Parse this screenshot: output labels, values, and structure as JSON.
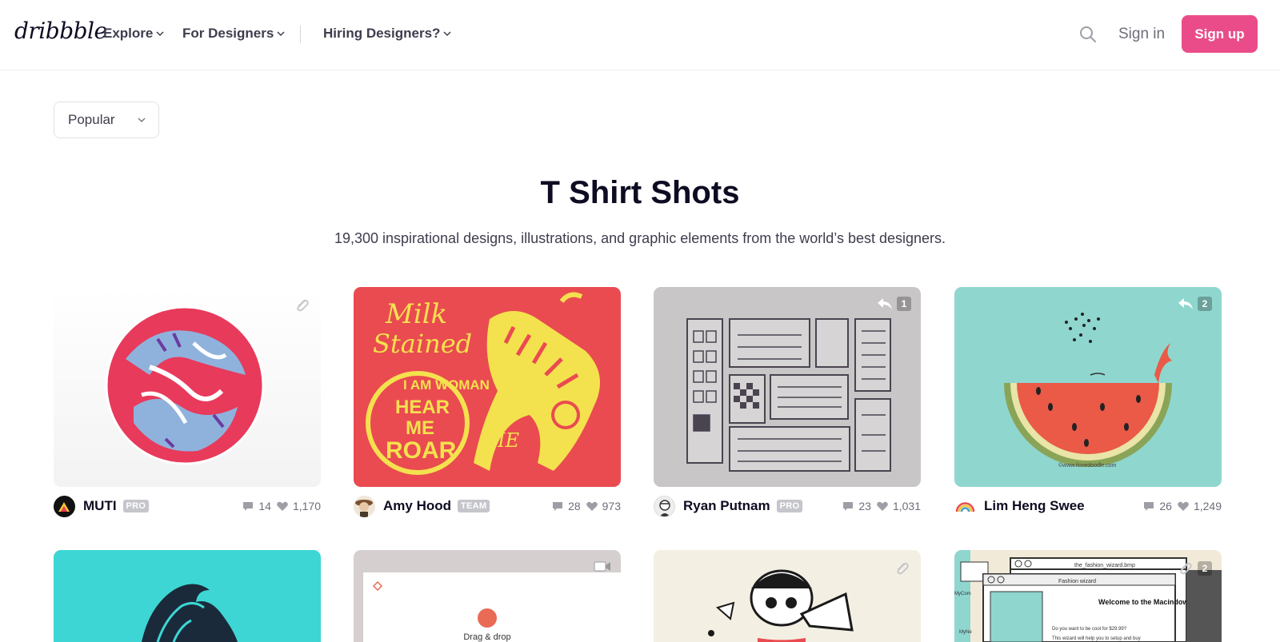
{
  "header": {
    "logo": "dribbble",
    "nav": [
      {
        "label": "Explore"
      },
      {
        "label": "For Designers"
      },
      {
        "label": "Hiring Designers?"
      }
    ],
    "signin": "Sign in",
    "signup": "Sign up"
  },
  "filter": {
    "selected": "Popular"
  },
  "page": {
    "title": "T Shirt Shots",
    "subtitle": "19,300 inspirational designs, illustrations, and graphic elements from the world’s best designers."
  },
  "shots": [
    {
      "author": "MUTI",
      "tag": "PRO",
      "comments": "14",
      "likes": "1,170",
      "badge_icon": "attachment-icon"
    },
    {
      "author": "Amy Hood",
      "tag": "TEAM",
      "comments": "28",
      "likes": "973",
      "artwork_text": {
        "line1": "Milk",
        "line2": "Stained",
        "circle1": "I AM WOMAN",
        "circle2": "HEAR",
        "circle3": "ME",
        "circle4": "ROAR",
        "sig": "ME"
      }
    },
    {
      "author": "Ryan Putnam",
      "tag": "PRO",
      "comments": "23",
      "likes": "1,031",
      "badge_icon": "rebound-icon",
      "badge_count": "1"
    },
    {
      "author": "Lim Heng Swee",
      "tag": "",
      "comments": "26",
      "likes": "1,249",
      "badge_icon": "rebound-icon",
      "badge_count": "2",
      "artwork_text": {
        "url": "©www.ilovedoodle.com"
      }
    }
  ],
  "shots_row2": [
    {
      "badge_icon": ""
    },
    {
      "badge_icon": "video-icon",
      "artwork_text": {
        "caption": "Drag & drop"
      }
    },
    {
      "badge_icon": "attachment-icon"
    },
    {
      "badge_icon": "attachment-icon",
      "badge_count": "2",
      "artwork_text": {
        "window_title": "the_fashion_wizard.bmp",
        "dialog_title": "Fashion wizard",
        "heading": "Welcome to the Macindows Fashion Wizard",
        "line1": "Do you want to be cool for $29.99?",
        "line2": "This wizard will help you to setup and buy",
        "side1": "MyCom",
        "side2": "MyNe"
      }
    }
  ],
  "colors": {
    "accent": "#ea4c89",
    "text": "#0d0c22",
    "muted": "#6e6d7a"
  }
}
